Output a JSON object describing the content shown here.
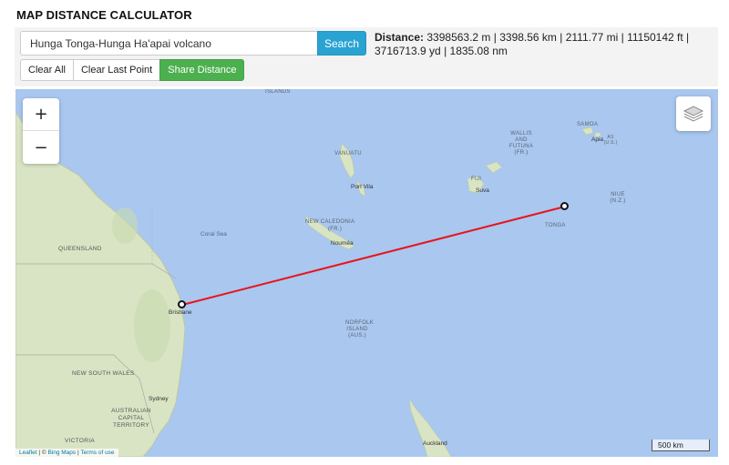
{
  "app": {
    "title": "MAP DISTANCE CALCULATOR"
  },
  "search": {
    "value": "Hunga Tonga-Hunga Ha'apai volcano",
    "button_label": "Search"
  },
  "distance": {
    "label": "Distance:",
    "text": "3398563.2 m | 3398.56 km | 2111.77 mi | 11150142 ft | 3716713.9 yd | 1835.08 nm"
  },
  "actions": {
    "clear_all": "Clear All",
    "clear_last": "Clear Last Point",
    "share": "Share Distance"
  },
  "map": {
    "zoom_in": "+",
    "zoom_out": "−",
    "layers_icon": "layers-icon",
    "scale": "500 km",
    "attribution": {
      "leaflet": "Leaflet",
      "separator": " | © ",
      "bing": "Bing Maps",
      "sep2": " | ",
      "terms": "Terms of use"
    },
    "labels": {
      "islands": "ISLANDS",
      "vanuatu": "VANUATU",
      "port_vila": "Port Vila",
      "new_caledonia": "NEW CALEDONIA",
      "new_caledonia_fr": "(FR.)",
      "noumea": "Nouméa",
      "coral_sea": "Coral Sea",
      "queensland": "QUEENSLAND",
      "brisbane": "Brisbane",
      "new_south_wales": "NEW SOUTH WALES",
      "sydney": "Sydney",
      "act": "AUSTRALIAN CAPITAL TERRITORY",
      "victoria": "VICTORIA",
      "norfolk": "NORFOLK ISLAND (AUS.)",
      "wallis": "WALLIS AND FUTUNA (FR.)",
      "fiji": "FIJI",
      "suva": "Suva",
      "samoa": "SAMOA",
      "apia": "Apia",
      "as": "AS (U.S.)",
      "tonga": "TONGA",
      "niue": "NIUE (N.Z.)",
      "auckland": "Auckland"
    },
    "route_color": "#e8141c",
    "water_color": "#a9c7ef",
    "land_color": "#d9e4c4"
  },
  "points": [
    {
      "name": "Brisbane",
      "lat": -27.47,
      "lon": 153.03
    },
    {
      "name": "Hunga Tonga-Hunga Ha'apai volcano",
      "lat": -20.55,
      "lon": -175.39
    }
  ]
}
